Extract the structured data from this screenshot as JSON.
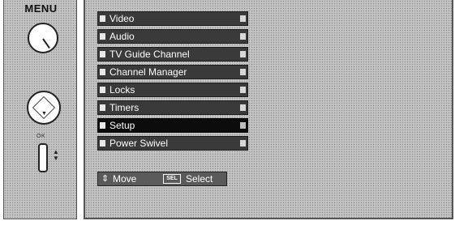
{
  "remote": {
    "menu_title": "MENU",
    "ok_label": "OK"
  },
  "menu": {
    "items": [
      {
        "label": "Video",
        "selected": false
      },
      {
        "label": "Audio",
        "selected": false
      },
      {
        "label": "TV Guide Channel",
        "selected": false
      },
      {
        "label": "Channel Manager",
        "selected": false
      },
      {
        "label": "Locks",
        "selected": false
      },
      {
        "label": "Timers",
        "selected": false
      },
      {
        "label": "Setup",
        "selected": true
      },
      {
        "label": "Power Swivel",
        "selected": false
      }
    ]
  },
  "hints": {
    "move_label": "Move",
    "select_key": "SEL",
    "select_label": "Select"
  },
  "icons": {
    "move": "up-down-arrow-icon",
    "select_key": "sel-key-icon",
    "dpad": "dpad-icon",
    "menu_button": "menu-button-icon"
  }
}
